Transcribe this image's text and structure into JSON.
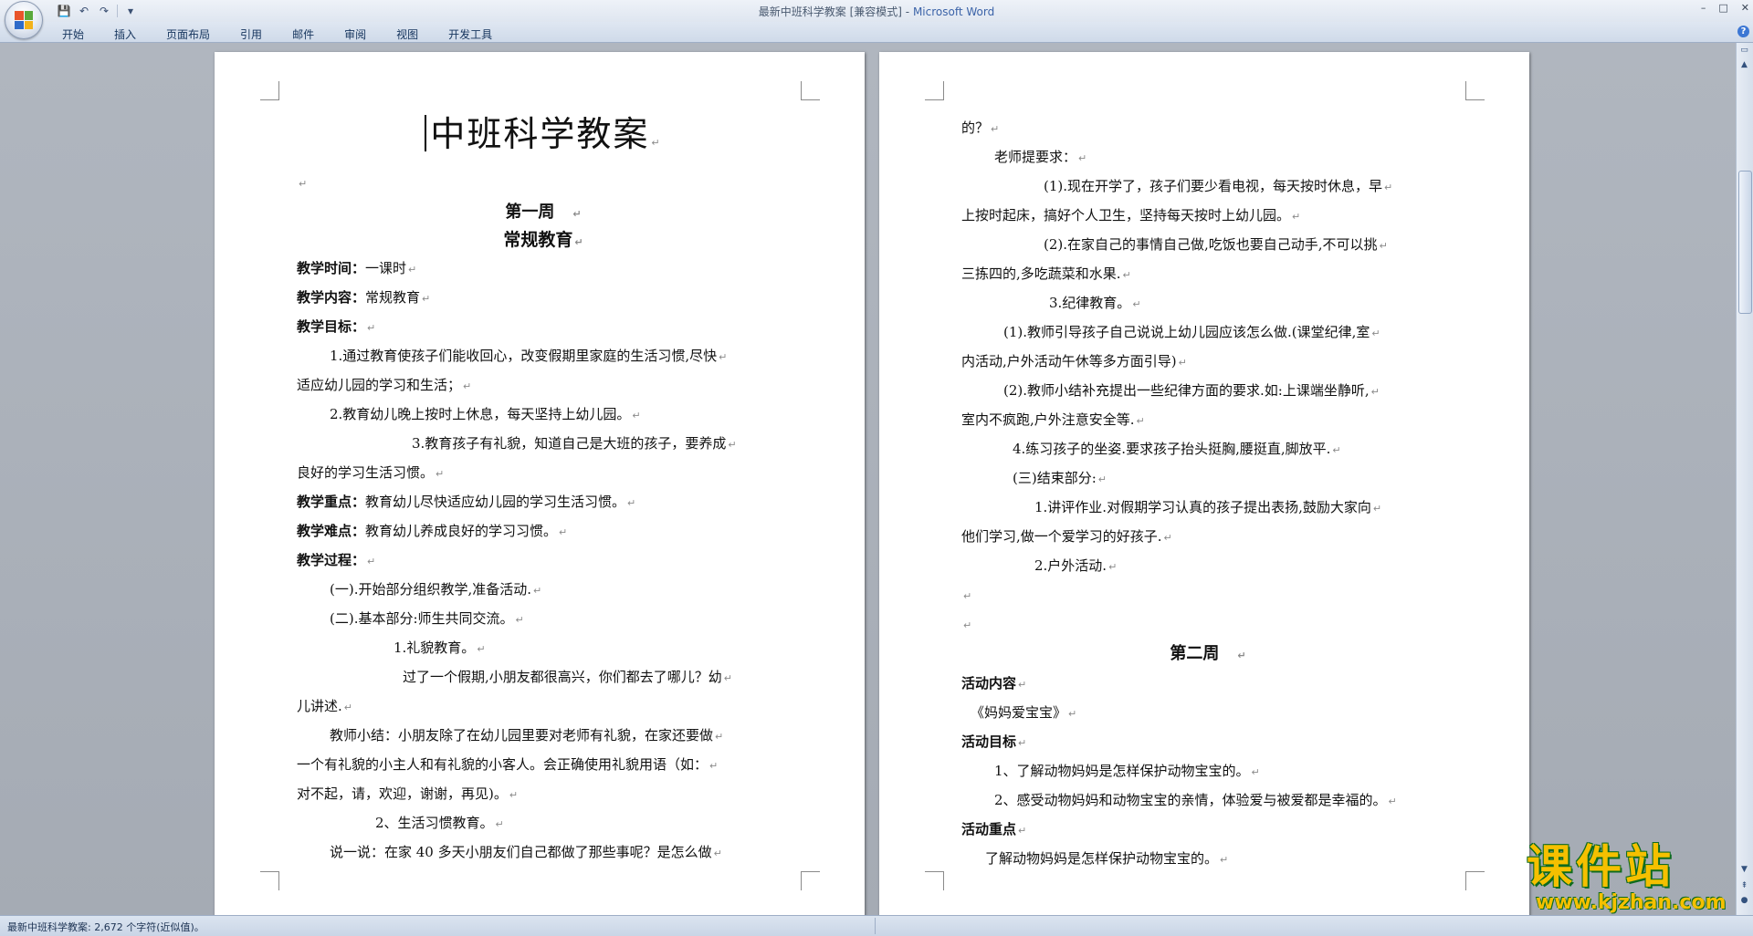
{
  "window": {
    "doc_name": "最新中班科学教案 [兼容模式]",
    "separator": " - ",
    "app_name": "Microsoft Word",
    "controls": [
      "–",
      "□",
      "✕"
    ]
  },
  "quick_access": {
    "save_icon": "💾",
    "undo_icon": "↶",
    "redo_icon": "↷",
    "customize_icon": "▾"
  },
  "ribbon": {
    "tabs": [
      "开始",
      "插入",
      "页面布局",
      "引用",
      "邮件",
      "审阅",
      "视图",
      "开发工具"
    ],
    "help": "?"
  },
  "page_left": {
    "title": "中班科学教案",
    "week": "第一周",
    "subject": "常规教育",
    "lines": [
      {
        "label": "教学时间：",
        "text": "一课时"
      },
      {
        "label": "教学内容：",
        "text": "常规教育"
      },
      {
        "label": "教学目标：",
        "text": ""
      },
      {
        "label": "",
        "text": "1.通过教育使孩子们能收回心，改变假期里家庭的生活习惯,尽快"
      },
      {
        "label": "",
        "text": "适应幼儿园的学习和生活；"
      },
      {
        "label": "",
        "text": "2.教育幼儿晚上按时上休息，每天坚持上幼儿园。"
      },
      {
        "label": "",
        "text": "3.教育孩子有礼貌，知道自己是大班的孩子，要养成"
      },
      {
        "label": "",
        "text": "良好的学习生活习惯。"
      },
      {
        "label": "教学重点：",
        "text": "教育幼儿尽快适应幼儿园的学习生活习惯。"
      },
      {
        "label": "教学难点：",
        "text": "教育幼儿养成良好的学习习惯。"
      },
      {
        "label": "教学过程：",
        "text": ""
      },
      {
        "label": "",
        "text": "(一).开始部分组织教学,准备活动."
      },
      {
        "label": "",
        "text": "(二).基本部分:师生共同交流。"
      },
      {
        "label": "",
        "text": "1.礼貌教育。"
      },
      {
        "label": "",
        "text": "过了一个假期,小朋友都很高兴，你们都去了哪儿？幼"
      },
      {
        "label": "",
        "text": "儿讲述."
      },
      {
        "label": "",
        "text": "教师小结：小朋友除了在幼儿园里要对老师有礼貌，在家还要做"
      },
      {
        "label": "",
        "text": "一个有礼貌的小主人和有礼貌的小客人。会正确使用礼貌用语（如："
      },
      {
        "label": "",
        "text": "对不起，请，欢迎，谢谢，再见)。"
      },
      {
        "label": "",
        "text": "2、生活习惯教育。"
      },
      {
        "label": "",
        "text": "说一说：在家 40 多天小朋友们自己都做了那些事呢？是怎么做"
      }
    ]
  },
  "page_right": {
    "lines": [
      {
        "label": "",
        "text": "的？"
      },
      {
        "label": "",
        "text": "老师提要求："
      },
      {
        "label": "",
        "text": "(1).现在开学了，孩子们要少看电视，每天按时休息，早"
      },
      {
        "label": "",
        "text": "上按时起床，搞好个人卫生，坚持每天按时上幼儿园。"
      },
      {
        "label": "",
        "text": "(2).在家自己的事情自己做,吃饭也要自己动手,不可以挑"
      },
      {
        "label": "",
        "text": "三拣四的,多吃蔬菜和水果."
      },
      {
        "label": "",
        "text": "3.纪律教育。"
      },
      {
        "label": "",
        "text": "(1).教师引导孩子自己说说上幼儿园应该怎么做.(课堂纪律,室"
      },
      {
        "label": "",
        "text": "内活动,户外活动午休等多方面引导)"
      },
      {
        "label": "",
        "text": "(2).教师小结补充提出一些纪律方面的要求.如:上课端坐静听,"
      },
      {
        "label": "",
        "text": "室内不疯跑,户外注意安全等."
      },
      {
        "label": "",
        "text": "4.练习孩子的坐姿.要求孩子抬头挺胸,腰挺直,脚放平."
      },
      {
        "label": "",
        "text": "(三)结束部分:"
      },
      {
        "label": "",
        "text": "1.讲评作业.对假期学习认真的孩子提出表扬,鼓励大家向"
      },
      {
        "label": "",
        "text": "他们学习,做一个爱学习的好孩子."
      },
      {
        "label": "",
        "text": "2.户外活动."
      },
      {
        "label": "",
        "text": ""
      },
      {
        "label": "",
        "text": ""
      },
      {
        "label": "",
        "text": "第二周",
        "heading": true
      },
      {
        "label": "活动内容",
        "text": ""
      },
      {
        "label": "",
        "text": "《妈妈爱宝宝》"
      },
      {
        "label": "活动目标",
        "text": ""
      },
      {
        "label": "",
        "text": "1、了解动物妈妈是怎样保护动物宝宝的。"
      },
      {
        "label": "",
        "text": "2、感受动物妈妈和动物宝宝的亲情，体验爱与被爱都是幸福的。"
      },
      {
        "label": "活动重点",
        "text": ""
      },
      {
        "label": "",
        "text": "了解动物妈妈是怎样保护动物宝宝的。"
      }
    ]
  },
  "status": {
    "text": "最新中班科学教案: 2,672 个字符(近似值)。"
  },
  "watermark": {
    "main": "课件站",
    "url": "www.kjzhan.com"
  },
  "paragraph_mark": "↵"
}
